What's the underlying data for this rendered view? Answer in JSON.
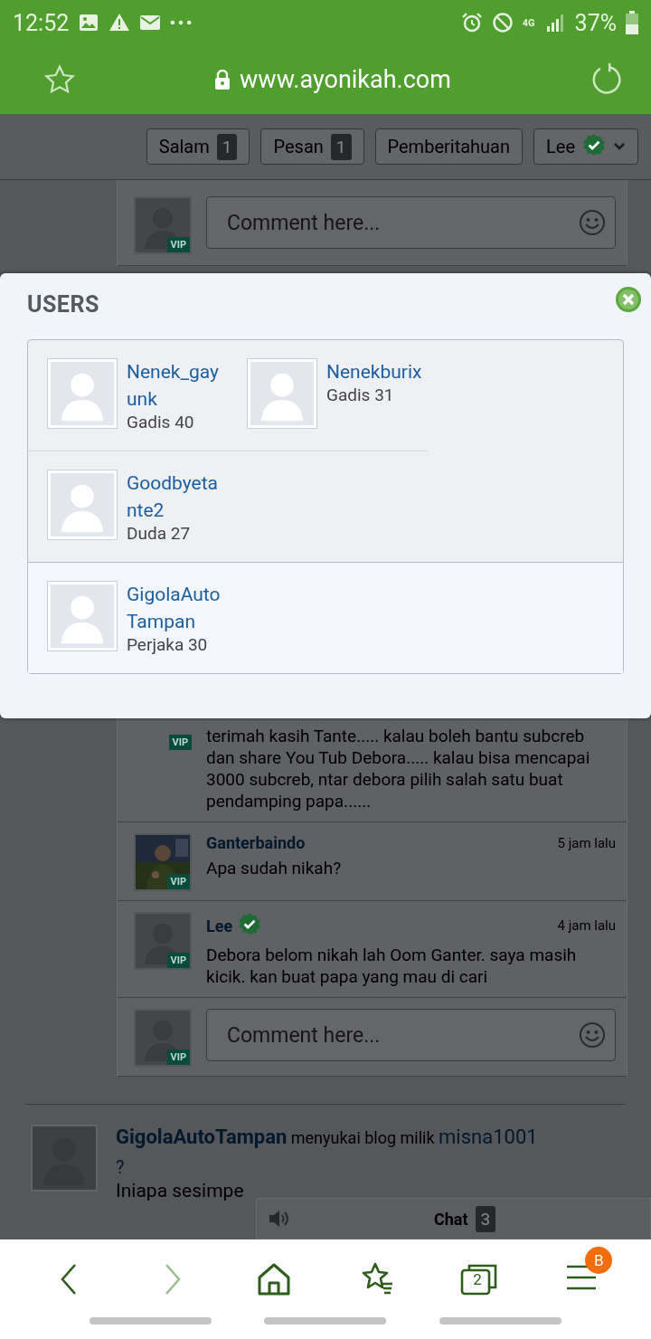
{
  "status_bar": {
    "time": "12:52",
    "network": "4G",
    "battery": "37%"
  },
  "browser": {
    "url": "www.ayonikah.com"
  },
  "site_nav": {
    "buttons": [
      {
        "label": "Salam",
        "count": "1"
      },
      {
        "label": "Pesan",
        "count": "1"
      },
      {
        "label": "Pemberitahuan"
      }
    ],
    "user": {
      "name": "Lee",
      "verified": true
    }
  },
  "comments": [
    {
      "kind": "input",
      "placeholder": "Comment here...",
      "badge": "VIP"
    },
    {
      "kind": "comment",
      "badge": "VIP",
      "text": "terimah kasih Tante..... kalau boleh bantu subcreb dan share You Tub Debora..... kalau bisa mencapai 3000 subcreb, ntar debora pilih salah satu buat pendamping papa......"
    },
    {
      "kind": "comment",
      "badge": "VIP",
      "author": "Ganterbaindo",
      "time": "5 jam lalu",
      "text": "Apa sudah nikah?"
    },
    {
      "kind": "comment",
      "badge": "VIP",
      "author": "Lee",
      "verified": true,
      "time": "4 jam lalu",
      "text": "Debora belom nikah lah Oom Ganter. saya masih kicik. kan buat papa yang mau di cari"
    },
    {
      "kind": "input",
      "placeholder": "Comment here...",
      "badge": "VIP"
    }
  ],
  "activity": {
    "user": "GigolaAutoTampan",
    "action": "menyukai blog milik",
    "target": "misna1001",
    "title": "?",
    "excerpt": "Iniapa sesimpe"
  },
  "chat": {
    "label": "Chat",
    "count": "3"
  },
  "modal": {
    "title": "USERS",
    "groups": [
      [
        {
          "name": "Nenek_gayunk",
          "info": "Gadis 40"
        },
        {
          "name": "Nenekburix",
          "info": "Gadis 31"
        },
        {
          "name": "Goodbyetante2",
          "info": "Duda 27"
        }
      ],
      [
        {
          "name": "GigolaAutoTampan",
          "info": "Perjaka 30"
        }
      ]
    ]
  },
  "bottom_nav": {
    "forward_disabled": true,
    "tabs_count": "2",
    "menu_badge": "B"
  }
}
